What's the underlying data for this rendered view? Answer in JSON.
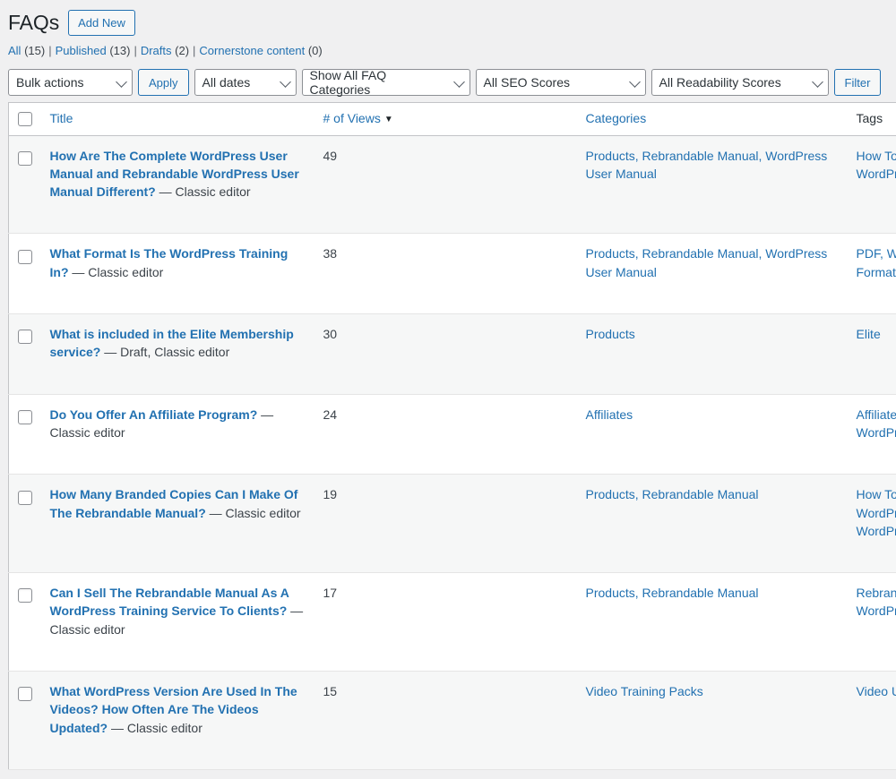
{
  "header": {
    "title": "FAQs",
    "add_new_label": "Add New"
  },
  "status_links": [
    {
      "label": "All",
      "count": "(15)"
    },
    {
      "label": "Published",
      "count": "(13)"
    },
    {
      "label": "Drafts",
      "count": "(2)"
    },
    {
      "label": "Cornerstone content",
      "count": "(0)"
    }
  ],
  "separator": "|",
  "toolbar": {
    "bulk_actions": "Bulk actions",
    "apply_label": "Apply",
    "all_dates": "All dates",
    "faq_categories": "Show All FAQ Categories",
    "seo_scores": "All SEO Scores",
    "readability_scores": "All Readability Scores",
    "filter_label": "Filter"
  },
  "table": {
    "columns": {
      "title": "Title",
      "views": "# of Views",
      "sort_indicator": "▼",
      "categories": "Categories",
      "tags": "Tags"
    },
    "rows": [
      {
        "title": "How Are The Complete WordPress User Manual and Rebrandable WordPress User Manual Different?",
        "state": " — Classic editor",
        "views": "49",
        "categories": "Products, Rebrandable Manual, WordPress User Manual",
        "tags": "How To Use The Complete WordPress User Manual"
      },
      {
        "title": "What Format Is The WordPress Training In?",
        "state": " — Classic editor",
        "views": "38",
        "categories": "Products, Rebrandable Manual, WordPress User Manual",
        "tags": "PDF, WordPress Training Format"
      },
      {
        "title": "What is included in the Elite Membership service?",
        "state": " — Draft, Classic editor",
        "views": "30",
        "categories": "Products",
        "tags": "Elite"
      },
      {
        "title": "Do You Offer An Affiliate Program?",
        "state": " — Classic editor",
        "views": "24",
        "categories": "Affiliates",
        "tags": "Affiliate, Affiliate Program, WordPress Affiliate"
      },
      {
        "title": "How Many Branded Copies Can I Make Of The Rebrandable Manual?",
        "state": " — Classic editor",
        "views": "19",
        "categories": "Products, Rebrandable Manual",
        "tags": "How To Use The Rebrandable WordPress User Manual, WordPress Training"
      },
      {
        "title": "Can I Sell The Rebrandable Manual As A WordPress Training Service To Clients?",
        "state": " — Classic editor",
        "views": "17",
        "categories": "Products, Rebrandable Manual",
        "tags": "Rebrandable Manual, WordPress Training Service"
      },
      {
        "title": "What WordPress Version Are Used In The Videos? How Often Are The Videos Updated?",
        "state": " — Classic editor",
        "views": "15",
        "categories": "Video Training Packs",
        "tags": "Video Updates"
      }
    ]
  },
  "colors": {
    "link": "#2271b1",
    "text": "#2c3338",
    "page_bg": "#f0f0f1",
    "row_alt": "#f6f7f7"
  }
}
